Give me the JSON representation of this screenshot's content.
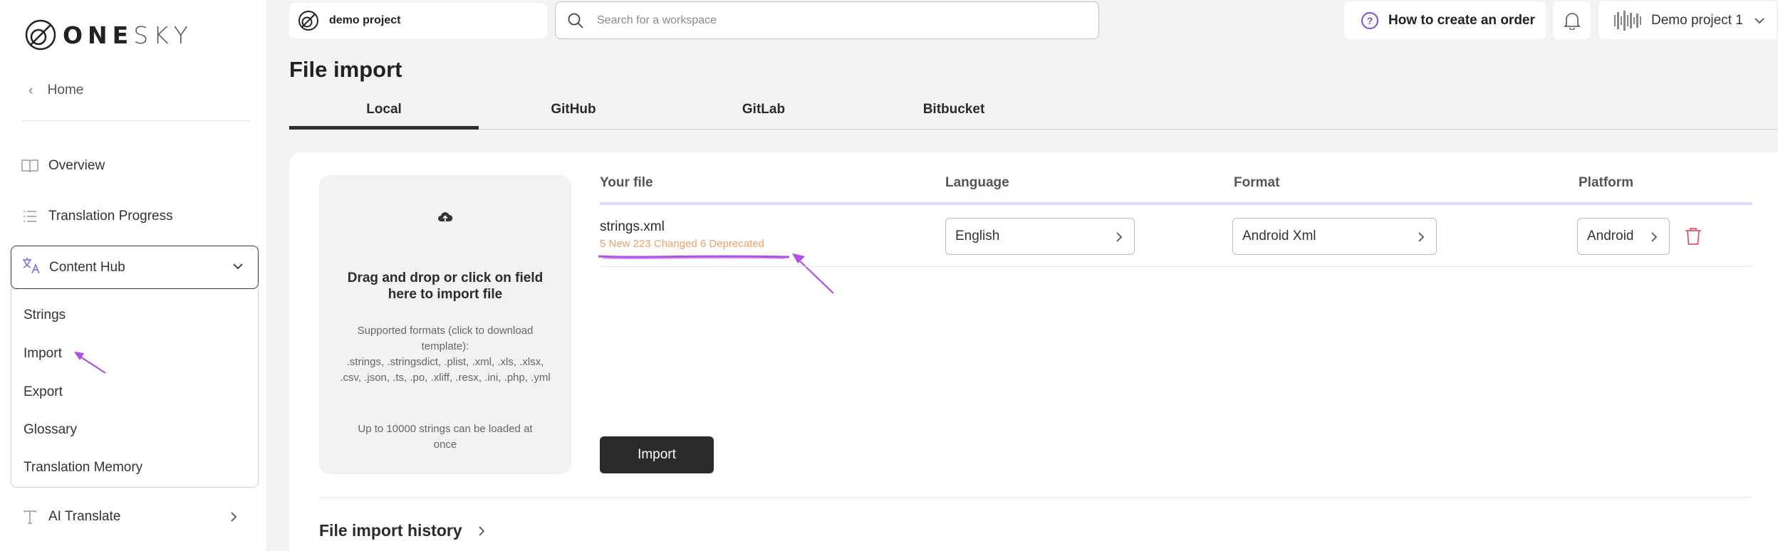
{
  "brand": {
    "logo_bold": "ONE",
    "logo_light": "SKY"
  },
  "sidebar": {
    "home_label": "Home",
    "items": [
      {
        "label": "Overview",
        "icon": "book-icon"
      },
      {
        "label": "Translation Progress",
        "icon": "list-icon"
      }
    ],
    "content_hub": {
      "label": "Content Hub",
      "icon": "translate-icon",
      "sub_items": [
        "Strings",
        "Import",
        "Export",
        "Glossary",
        "Translation Memory"
      ]
    },
    "ai_translate_label": "AI Translate"
  },
  "topbar": {
    "project_name": "demo project",
    "search_placeholder": "Search for a workspace",
    "help_label": "How to create an order",
    "user_label": "Demo project 1"
  },
  "page": {
    "title": "File import",
    "tabs": [
      "Local",
      "GitHub",
      "GitLab",
      "Bitbucket"
    ],
    "active_tab": "Local"
  },
  "dropzone": {
    "title": "Drag and drop or click on field here to import file",
    "formats_intro": "Supported formats (click to download template):",
    "formats": ".strings, .stringsdict, .plist, .xml, .xls, .xlsx, .csv, .json, .ts, .po, .xliff, .resx, .ini, .php, .yml",
    "limit": "Up to 10000 strings can be loaded at once"
  },
  "file_table": {
    "headers": {
      "file": "Your file",
      "language": "Language",
      "format": "Format",
      "platform": "Platform"
    },
    "row": {
      "file_name": "strings.xml",
      "stats": "5 New 223 Changed 6 Deprecated",
      "language": "English",
      "format": "Android Xml",
      "platform": "Android"
    }
  },
  "import_button": "Import",
  "history_title": "File import history",
  "colors": {
    "accent_purple": "#b44ee8",
    "stats_orange": "#e8a26a",
    "delete_red": "#e2566b",
    "button_dark": "#2b2b2b"
  }
}
